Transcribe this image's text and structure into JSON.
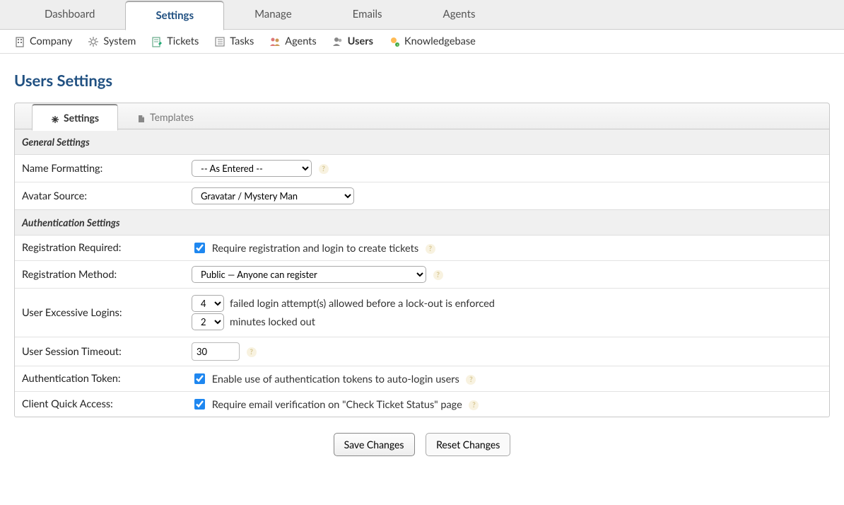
{
  "topnav": {
    "items": [
      {
        "label": "Dashboard"
      },
      {
        "label": "Settings",
        "active": true
      },
      {
        "label": "Manage"
      },
      {
        "label": "Emails"
      },
      {
        "label": "Agents"
      }
    ]
  },
  "subnav": {
    "items": [
      {
        "label": "Company"
      },
      {
        "label": "System"
      },
      {
        "label": "Tickets"
      },
      {
        "label": "Tasks"
      },
      {
        "label": "Agents"
      },
      {
        "label": "Users",
        "active": true
      },
      {
        "label": "Knowledgebase"
      }
    ]
  },
  "page": {
    "title": "Users Settings"
  },
  "tabs": {
    "settings": "Settings",
    "templates": "Templates"
  },
  "sections": {
    "general": "General Settings",
    "auth": "Authentication Settings"
  },
  "fields": {
    "name_formatting": {
      "label": "Name Formatting:",
      "value": "-- As Entered --"
    },
    "avatar_source": {
      "label": "Avatar Source:",
      "value": "Gravatar / Mystery Man"
    },
    "registration_required": {
      "label": "Registration Required:",
      "checked": true,
      "text": "Require registration and login to create tickets"
    },
    "registration_method": {
      "label": "Registration Method:",
      "value": "Public — Anyone can register"
    },
    "excessive_logins": {
      "label": "User Excessive Logins:",
      "attempts_value": "4",
      "attempts_text": "failed login attempt(s) allowed before a lock-out is enforced",
      "lockout_value": "2",
      "lockout_text": "minutes locked out"
    },
    "session_timeout": {
      "label": "User Session Timeout:",
      "value": "30"
    },
    "auth_token": {
      "label": "Authentication Token:",
      "checked": true,
      "text": "Enable use of authentication tokens to auto-login users"
    },
    "quick_access": {
      "label": "Client Quick Access:",
      "checked": true,
      "text": "Require email verification on \"Check Ticket Status\" page"
    }
  },
  "buttons": {
    "save": "Save Changes",
    "reset": "Reset Changes"
  }
}
